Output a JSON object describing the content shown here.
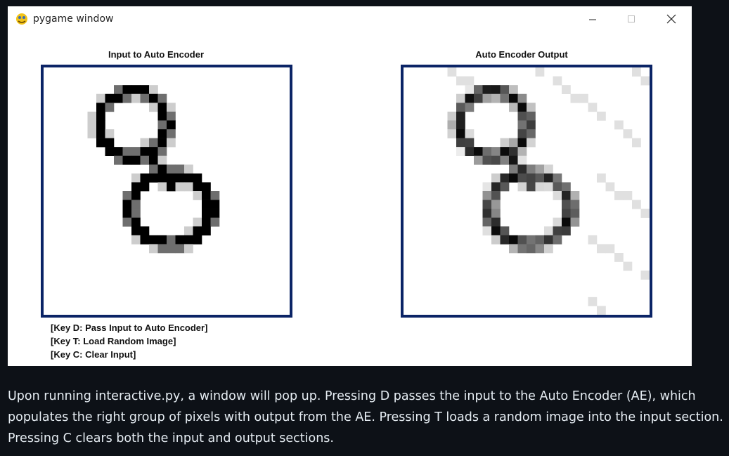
{
  "window": {
    "title": "pygame window"
  },
  "panels": {
    "input_title": "Input to Auto Encoder",
    "output_title": "Auto Encoder Output"
  },
  "keys": {
    "d": "[Key D: Pass Input to Auto Encoder]",
    "t": "[Key T: Load Random Image]",
    "c": "[Key C: Clear Input]"
  },
  "caption": "Upon running interactive.py, a window will pop up. Pressing D passes the input to the Auto Encoder (AE), which populates the right group of pixels with output from the AE. Pressing T loads a random image into the input section. Pressing C clears both the input and output sections.",
  "grid": {
    "rows": 28,
    "cols": 28
  },
  "colors": {
    "frame": "#0b2466",
    "page_bg": "#0d1117",
    "caption_text": "#e6edf3"
  },
  "icons": {
    "app": "pygame-snake-icon",
    "minimize": "minimize-icon",
    "maximize": "maximize-icon",
    "close": "close-icon"
  }
}
